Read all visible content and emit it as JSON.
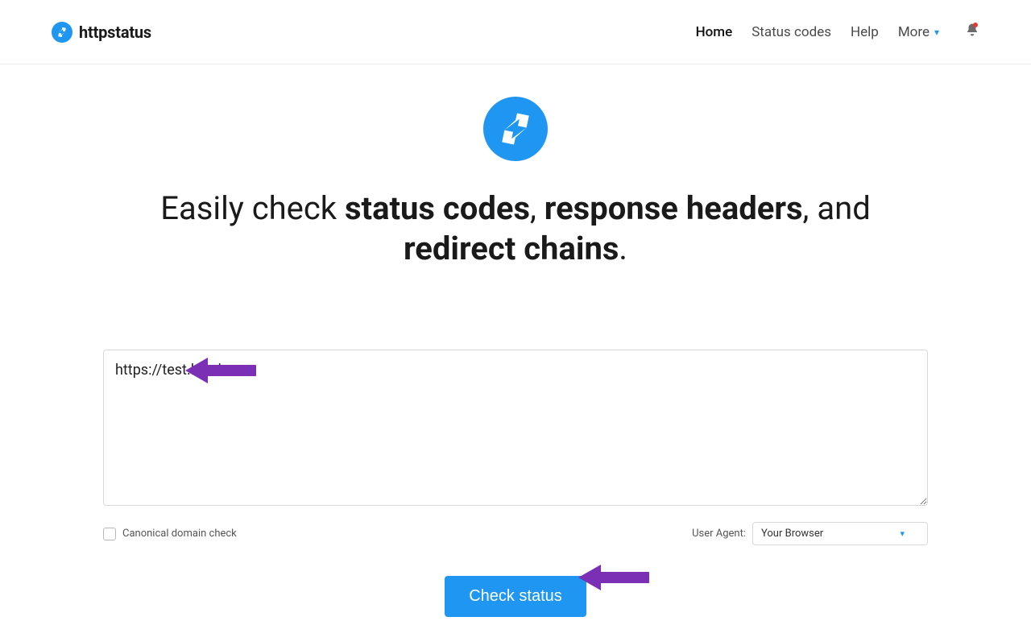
{
  "brand": {
    "name": "httpstatus"
  },
  "nav": {
    "home": "Home",
    "status_codes": "Status codes",
    "help": "Help",
    "more": "More"
  },
  "headline": {
    "pre": "Easily check ",
    "b1": "status codes",
    "sep1": ", ",
    "b2": "response headers",
    "sep2": ", and ",
    "b3": "redirect chains",
    "post": "."
  },
  "form": {
    "url_value": "https://test.local",
    "canonical_label": "Canonical domain check",
    "ua_label": "User Agent:",
    "ua_selected": "Your Browser",
    "submit_label": "Check status"
  }
}
